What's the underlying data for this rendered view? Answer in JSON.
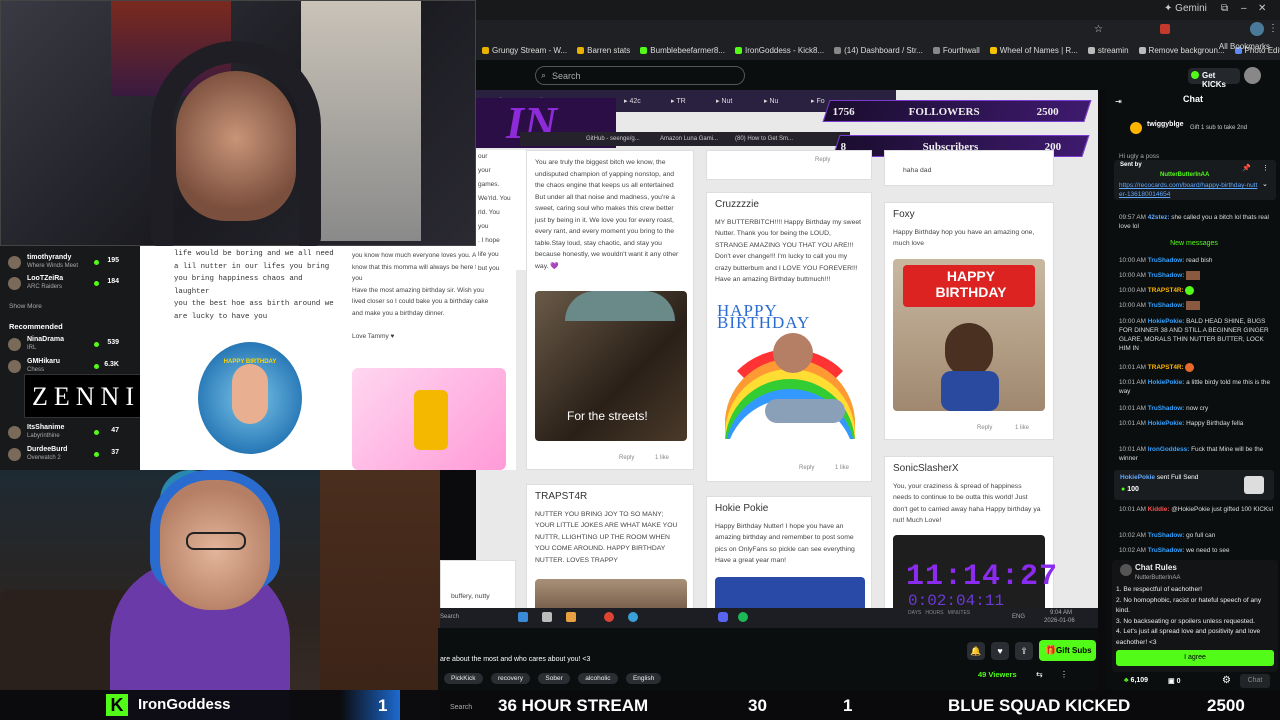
{
  "browser": {
    "tab_label": "Gemini",
    "bookmarks": [
      "Grungy Stream - W...",
      "Barren stats",
      "Bumblebeefarmer8...",
      "IronGoddess - Kick8...",
      "(14) Dashboard / Str...",
      "Fourthwall",
      "Wheel of Names | R...",
      "streamin",
      "Remove backgroun...",
      "Photo Editor : Pixlr..."
    ],
    "all_bookmarks": "All Bookmarks"
  },
  "kick": {
    "search_placeholder": "Search",
    "get_kicks": "Get KICKs",
    "chat_title": "Chat"
  },
  "overlay": {
    "followers_label": "FOLLOWERS",
    "followers_count": "1756",
    "followers_goal": "2500",
    "subs_label": "Subscribers",
    "subs_count": "8",
    "subs_goal": "200",
    "brand_text": "IN AA",
    "timer": "11:14:27",
    "timer_sub": "0:02:04:11",
    "timer_units": "DAYS   HOURS   MINUTES",
    "stream_text": "36 HOUR STREAM",
    "stream_num_left": "1",
    "stream_num_mid": "30",
    "stream_num_right": "1",
    "squad_text": "BLUE SQUAD KICKED",
    "goal_number": "2500",
    "streamer_name": "IronGoddess"
  },
  "cards": [
    {
      "name": "",
      "msg": "You are truly the biggest bitch we know, the\nundisputed champion of yapping nonstop, and\nthe chaos engine that keeps us all entertained\nBut under all that noise and madness, you're a\nsweet, caring soul who makes this crew better\njust by being in it. We love you for every roast,\nevery rant, and every moment you bring to the\ntable.Stay loud, stay chaotic, and stay you\nbecause honestly, we wouldn't want it any other\nway. 💜"
    },
    {
      "name": "Cruzzzzie",
      "msg": "MY BUTTERBITCH!!!! Happy Birthday my sweet\nNutter. Thank you for being the LOUD,\nSTRANGE AMAZING YOU THAT YOU ARE!!!\nDon't ever change!!! I'm lucky to call you my\ncrazy butterbum and I LOVE YOU FOREVER!!!\nHave an amazing Birthday buttmuch!!!"
    },
    {
      "name": "Foxy",
      "msg": "Happy Birthday hop you have an amazing one,\nmuch love"
    },
    {
      "name": "TRAPST4R",
      "msg": "NUTTER YOU BRING JOY TO SO MANY;\nYOUR LITTLE JOKES ARE WHAT MAKE YOU\nNUTTR, LLIGHTING UP THE ROOM WHEN\nYOU COME AROUND. HAPPY BIRTHDAY\nNUTTER. LOVES TRAPPY"
    },
    {
      "name": "Hokie Pokie",
      "msg": "Happy Birthday Nutter! I hope you have an\namazing birthday and remember to post some\npics on OnlyFans so pickle can see everything\nHave a great year man!"
    },
    {
      "name": "SonicSlasherX",
      "msg": "You, your craziness & spread of happiness\nneeds to continue to be outta this world! Just\ndon't get to carried away haha Happy birthday ya\nnut! Much Love!"
    }
  ],
  "card_misc": {
    "reply": "Reply",
    "like": "1 like",
    "haha": "haha dad",
    "streets": "For the streets!",
    "hb_text": "HAPPY BIRTHDAY",
    "hb_text2": "HAPPY BIRTHDAY",
    "buffery": "buffery, nutty"
  },
  "white_left": {
    "msg": "life would be boring and we all need\na lil nutter in our lifes you bring\nyou bring happiness chaos and\nlaughter\nyou the best hoe ass birth around we\nare lucky to have you",
    "cake_label": "HAPPY BIRTHDAY"
  },
  "white_mid": {
    "msg": "you know how much everyone loves you. And\nknow that this momma will always be here for\nyou\nHave the most amazing birthday sir. Wish you\nlived closer so I could bake you a birthday cake\nand make you a birthday dinner.\n\nLove Tammy ♥",
    "side": "our\nyour\ngames.\nWe'rld. You\nrld. You\nyou\n. I hope\nlife you\nbut you"
  },
  "sidebar": {
    "items": [
      {
        "name": "timothyrandy",
        "cat": "Where Winds Meet",
        "viewers": "195"
      },
      {
        "name": "LooTZeiRa",
        "cat": "ARC Raiders",
        "viewers": "184"
      }
    ],
    "show_more": "Show More",
    "recommended": "Recommended",
    "rec": [
      {
        "name": "NinaDrama",
        "cat": "IRL",
        "viewers": "539"
      },
      {
        "name": "GMHikaru",
        "cat": "Chess",
        "viewers": "6.3K"
      },
      {
        "name": "ItsShanime",
        "cat": "Labyrinthine",
        "viewers": "47"
      },
      {
        "name": "DurdeeBurd",
        "cat": "Overwatch 2",
        "viewers": "37"
      }
    ],
    "zenni": "ZENNI"
  },
  "below_player": {
    "title": "are about the most and who cares about you! <3",
    "tags": [
      "PickKick",
      "recovery",
      "Sober",
      "alcoholic",
      "English"
    ],
    "viewers": "49 Viewers",
    "gift_subs": "Gift Subs"
  },
  "chat": {
    "pinned_user": "twiggyblge",
    "pinned_text": "Gift 1 sub to take 2nd",
    "sent_by": "Sent by",
    "sender": "NutterButterInAA",
    "link": "https://recocards.com/board/happy-birthday-nutter-136180014654",
    "partial": "Hi ugly a poss",
    "messages": [
      {
        "time": "09:57 AM",
        "user": "42stez:",
        "text": "she called you a bitch lol thats real love lol",
        "color": "#5fa8ff"
      },
      {
        "time": "10:00 AM",
        "user": "TruShadow:",
        "text": "read bish",
        "color": "#33a1ff"
      },
      {
        "time": "10:00 AM",
        "user": "TruShadow:",
        "text": "",
        "color": "#33a1ff"
      },
      {
        "time": "10:00 AM",
        "user": "TRAPST4R:",
        "text": "",
        "color": "#ffb400"
      },
      {
        "time": "10:00 AM",
        "user": "TruShadow:",
        "text": "",
        "color": "#33a1ff"
      },
      {
        "time": "10:00 AM",
        "user": "HokiePokie:",
        "text": "BALD HEAD SHINE, BUGS FOR DINNER 38 AND STILL A BEGINNER GINGER GLARE, MORALS THIN NUTTER BUTTER, LOCK HIM IN",
        "color": "#33a1ff"
      },
      {
        "time": "10:01 AM",
        "user": "TRAPST4R:",
        "text": "",
        "color": "#ffb400"
      },
      {
        "time": "10:01 AM",
        "user": "HokiePokie:",
        "text": "a little birdy told me this is the way",
        "color": "#33a1ff"
      },
      {
        "time": "10:01 AM",
        "user": "TruShadow:",
        "text": "now cry",
        "color": "#33a1ff"
      },
      {
        "time": "10:01 AM",
        "user": "HokiePokie:",
        "text": "Happy Birthday fella",
        "color": "#33a1ff"
      },
      {
        "time": "10:01 AM",
        "user": "IronGoddess:",
        "text": "Fuck that Mine will be the winner",
        "color": "#33a1ff"
      }
    ],
    "new_messages": "New messages",
    "send_user": "HokiePokie",
    "send_text": "sent Full Send",
    "send_amount": "100",
    "later": [
      {
        "time": "10:01 AM",
        "user": "Kiddie:",
        "text": "@HokiePokie just gifted 100 KICKs!",
        "color": "#ff4d4d"
      },
      {
        "time": "10:02 AM",
        "user": "TruShadow:",
        "text": "go full can",
        "color": "#33a1ff"
      },
      {
        "time": "10:02 AM",
        "user": "TruShadow:",
        "text": "we need to see",
        "color": "#33a1ff"
      }
    ],
    "rules_title": "Chat Rules",
    "rules_owner": "NutterButterInAA",
    "rules": "1. Be respectful of eachother!\n2. No homophobic, racist or hateful speech of any kind.\n3. No backseating or spoilers unless requested.\n4. Let's just all spread love and positivity and love eachother! <3",
    "agree": "I agree",
    "kicks_count": "6,109",
    "zero": "0",
    "chat_btn": "Chat"
  },
  "taskbar": {
    "search": "Search",
    "time": "9:04 AM",
    "date": "2026-01-06",
    "lang": "ENG"
  }
}
